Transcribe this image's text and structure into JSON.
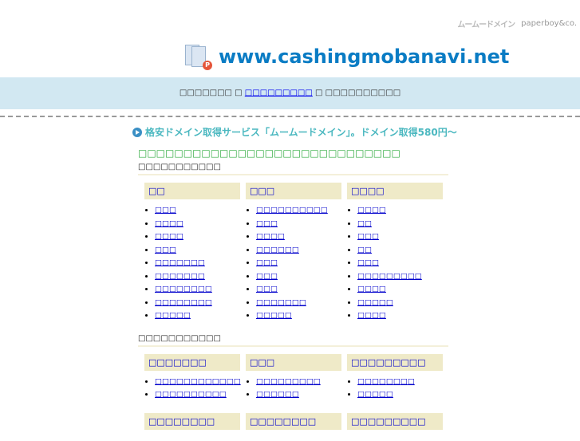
{
  "brand": {
    "mumu_logo": "ムームードメイン",
    "paperboy_logo": "paperboy&co."
  },
  "header": {
    "site_title": "www.cashingmobanavi.net"
  },
  "band": {
    "text_before": "□□□□□□□ □",
    "link": "□□□□□□□□□",
    "text_after": "□ □□□□□□□□□□"
  },
  "promo": {
    "text": "格安ドメイン取得サービス「ムームードメイン」。ドメイン取得580円～"
  },
  "main": {
    "green_text": "□□□□□□□□□□□□□□□□□□□□□□□□□□□□□",
    "sections": [
      {
        "title": "□□□□□□□□□□□",
        "columns": [
          {
            "header": "□□",
            "items": [
              "□□□",
              "□□□□",
              "□□□□",
              "□□□",
              "□□□□□□□",
              "□□□□□□□",
              "□□□□□□□□",
              "□□□□□□□□",
              "□□□□□"
            ]
          },
          {
            "header": "□□□",
            "items": [
              "□□□□□□□□□□",
              "□□□",
              "□□□□",
              "□□□□□□",
              "□□□",
              "□□□",
              "□□□",
              "□□□□□□□",
              "□□□□□"
            ]
          },
          {
            "header": "□□□□",
            "items": [
              "□□□□",
              "□□",
              "□□□",
              "□□",
              "□□□",
              "□□□□□□□□□",
              "□□□□",
              "□□□□□",
              "□□□□"
            ]
          }
        ]
      },
      {
        "title": "□□□□□□□□□□□",
        "columns": [
          {
            "header": "□□□□□□□",
            "items": [
              "□□□□□□□□□□□□",
              "□□□□□□□□□□"
            ]
          },
          {
            "header": "□□□",
            "items": [
              "□□□□□□□□□",
              "□□□□□□"
            ]
          },
          {
            "header": "□□□□□□□□□",
            "items": [
              "□□□□□□□□",
              "□□□□□"
            ]
          }
        ]
      },
      {
        "columns": [
          {
            "header": "□□□□□□□□"
          },
          {
            "header": "□□□□□□□□"
          },
          {
            "header": "□□□□□□□□□"
          }
        ]
      }
    ]
  }
}
